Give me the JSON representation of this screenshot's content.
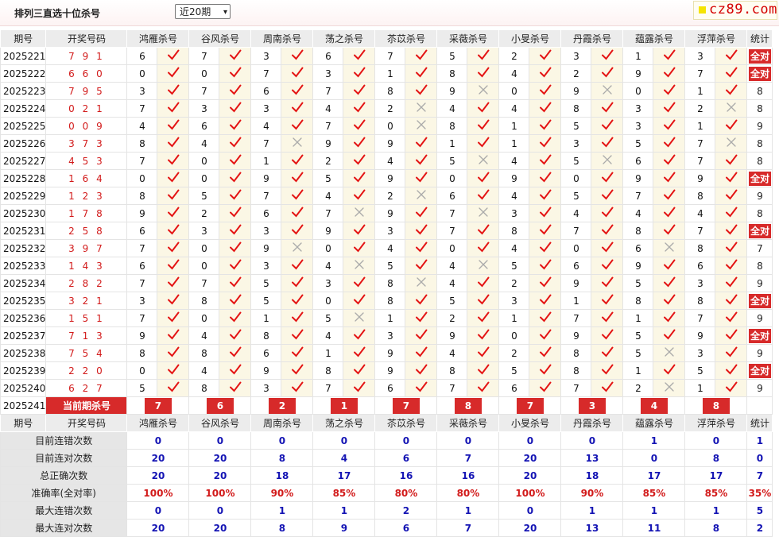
{
  "header": {
    "title": "排列三直选十位杀号",
    "period_select": "近20期",
    "logo": "cz89.com"
  },
  "columns": {
    "issue": "期号",
    "draw": "开奖号码",
    "experts": [
      "鸿雁杀号",
      "谷风杀号",
      "周南杀号",
      "荡之杀号",
      "苶苡杀号",
      "采薇杀号",
      "小旻杀号",
      "丹霞杀号",
      "蕴露杀号",
      "浮萍杀号"
    ],
    "stats": "统计"
  },
  "rows": [
    {
      "issue": "2025221",
      "draw": "7 9 1",
      "kills": [
        6,
        7,
        3,
        6,
        7,
        5,
        2,
        3,
        1,
        3
      ],
      "ok": [
        1,
        1,
        1,
        1,
        1,
        1,
        1,
        1,
        1,
        1
      ],
      "stat": "全对"
    },
    {
      "issue": "2025222",
      "draw": "6 6 0",
      "kills": [
        0,
        0,
        7,
        3,
        1,
        8,
        4,
        2,
        9,
        7
      ],
      "ok": [
        1,
        1,
        1,
        1,
        1,
        1,
        1,
        1,
        1,
        1
      ],
      "stat": "全对"
    },
    {
      "issue": "2025223",
      "draw": "7 9 5",
      "kills": [
        3,
        7,
        6,
        7,
        8,
        9,
        0,
        9,
        0,
        1
      ],
      "ok": [
        1,
        1,
        1,
        1,
        1,
        0,
        1,
        0,
        1,
        1
      ],
      "stat": "8"
    },
    {
      "issue": "2025224",
      "draw": "0 2 1",
      "kills": [
        7,
        3,
        3,
        4,
        2,
        4,
        4,
        8,
        3,
        2
      ],
      "ok": [
        1,
        1,
        1,
        1,
        0,
        1,
        1,
        1,
        1,
        0
      ],
      "stat": "8"
    },
    {
      "issue": "2025225",
      "draw": "0 0 9",
      "kills": [
        4,
        6,
        4,
        7,
        0,
        8,
        1,
        5,
        3,
        1
      ],
      "ok": [
        1,
        1,
        1,
        1,
        0,
        1,
        1,
        1,
        1,
        1
      ],
      "stat": "9"
    },
    {
      "issue": "2025226",
      "draw": "3 7 3",
      "kills": [
        8,
        4,
        7,
        9,
        9,
        1,
        1,
        3,
        5,
        7
      ],
      "ok": [
        1,
        1,
        0,
        1,
        1,
        1,
        1,
        1,
        1,
        0
      ],
      "stat": "8"
    },
    {
      "issue": "2025227",
      "draw": "4 5 3",
      "kills": [
        7,
        0,
        1,
        2,
        4,
        5,
        4,
        5,
        6,
        7
      ],
      "ok": [
        1,
        1,
        1,
        1,
        1,
        0,
        1,
        0,
        1,
        1
      ],
      "stat": "8"
    },
    {
      "issue": "2025228",
      "draw": "1 6 4",
      "kills": [
        0,
        0,
        9,
        5,
        9,
        0,
        9,
        0,
        9,
        9
      ],
      "ok": [
        1,
        1,
        1,
        1,
        1,
        1,
        1,
        1,
        1,
        1
      ],
      "stat": "全对"
    },
    {
      "issue": "2025229",
      "draw": "1 2 3",
      "kills": [
        8,
        5,
        7,
        4,
        2,
        6,
        4,
        5,
        7,
        8
      ],
      "ok": [
        1,
        1,
        1,
        1,
        0,
        1,
        1,
        1,
        1,
        1
      ],
      "stat": "9"
    },
    {
      "issue": "2025230",
      "draw": "1 7 8",
      "kills": [
        9,
        2,
        6,
        7,
        9,
        7,
        3,
        4,
        4,
        4
      ],
      "ok": [
        1,
        1,
        1,
        0,
        1,
        0,
        1,
        1,
        1,
        1
      ],
      "stat": "8"
    },
    {
      "issue": "2025231",
      "draw": "2 5 8",
      "kills": [
        6,
        3,
        3,
        9,
        3,
        7,
        8,
        7,
        8,
        7
      ],
      "ok": [
        1,
        1,
        1,
        1,
        1,
        1,
        1,
        1,
        1,
        1
      ],
      "stat": "全对"
    },
    {
      "issue": "2025232",
      "draw": "3 9 7",
      "kills": [
        7,
        0,
        9,
        0,
        4,
        0,
        4,
        0,
        6,
        8
      ],
      "ok": [
        1,
        1,
        0,
        1,
        1,
        1,
        1,
        1,
        0,
        1
      ],
      "stat": "7"
    },
    {
      "issue": "2025233",
      "draw": "1 4 3",
      "kills": [
        6,
        0,
        3,
        4,
        5,
        4,
        5,
        6,
        9,
        6
      ],
      "ok": [
        1,
        1,
        1,
        0,
        1,
        0,
        1,
        1,
        1,
        1
      ],
      "stat": "8"
    },
    {
      "issue": "2025234",
      "draw": "2 8 2",
      "kills": [
        7,
        7,
        5,
        3,
        8,
        4,
        2,
        9,
        5,
        3
      ],
      "ok": [
        1,
        1,
        1,
        1,
        0,
        1,
        1,
        1,
        1,
        1
      ],
      "stat": "9"
    },
    {
      "issue": "2025235",
      "draw": "3 2 1",
      "kills": [
        3,
        8,
        5,
        0,
        8,
        5,
        3,
        1,
        8,
        8
      ],
      "ok": [
        1,
        1,
        1,
        1,
        1,
        1,
        1,
        1,
        1,
        1
      ],
      "stat": "全对"
    },
    {
      "issue": "2025236",
      "draw": "1 5 1",
      "kills": [
        7,
        0,
        1,
        5,
        1,
        2,
        1,
        7,
        1,
        7
      ],
      "ok": [
        1,
        1,
        1,
        0,
        1,
        1,
        1,
        1,
        1,
        1
      ],
      "stat": "9"
    },
    {
      "issue": "2025237",
      "draw": "7 1 3",
      "kills": [
        9,
        4,
        8,
        4,
        3,
        9,
        0,
        9,
        5,
        9
      ],
      "ok": [
        1,
        1,
        1,
        1,
        1,
        1,
        1,
        1,
        1,
        1
      ],
      "stat": "全对"
    },
    {
      "issue": "2025238",
      "draw": "7 5 4",
      "kills": [
        8,
        8,
        6,
        1,
        9,
        4,
        2,
        8,
        5,
        3
      ],
      "ok": [
        1,
        1,
        1,
        1,
        1,
        1,
        1,
        1,
        0,
        1
      ],
      "stat": "9"
    },
    {
      "issue": "2025239",
      "draw": "2 2 0",
      "kills": [
        0,
        4,
        9,
        8,
        9,
        8,
        5,
        8,
        1,
        5
      ],
      "ok": [
        1,
        1,
        1,
        1,
        1,
        1,
        1,
        1,
        1,
        1
      ],
      "stat": "全对"
    },
    {
      "issue": "2025240",
      "draw": "6 2 7",
      "kills": [
        5,
        8,
        3,
        7,
        6,
        7,
        6,
        7,
        2,
        1
      ],
      "ok": [
        1,
        1,
        1,
        1,
        1,
        1,
        1,
        1,
        0,
        1
      ],
      "stat": "9"
    }
  ],
  "current": {
    "issue": "2025241",
    "label": "当前期杀号",
    "kills": [
      "7",
      "6",
      "2",
      "1",
      "7",
      "8",
      "7",
      "3",
      "4",
      "8"
    ]
  },
  "stats": [
    {
      "label": "目前连错次数",
      "values": [
        "0",
        "0",
        "0",
        "0",
        "0",
        "0",
        "0",
        "0",
        "1",
        "0"
      ],
      "total": "1"
    },
    {
      "label": "目前连对次数",
      "values": [
        "20",
        "20",
        "8",
        "4",
        "6",
        "7",
        "20",
        "13",
        "0",
        "8"
      ],
      "total": "0"
    },
    {
      "label": "总正确次数",
      "values": [
        "20",
        "20",
        "18",
        "17",
        "16",
        "16",
        "20",
        "18",
        "17",
        "17"
      ],
      "total": "7"
    },
    {
      "label": "准确率(全对率)",
      "values": [
        "100%",
        "100%",
        "90%",
        "85%",
        "80%",
        "80%",
        "100%",
        "90%",
        "85%",
        "85%"
      ],
      "total": "35%",
      "red": true
    },
    {
      "label": "最大连错次数",
      "values": [
        "0",
        "0",
        "1",
        "1",
        "2",
        "1",
        "0",
        "1",
        "1",
        "1"
      ],
      "total": "5"
    },
    {
      "label": "最大连对次数",
      "values": [
        "20",
        "20",
        "8",
        "9",
        "6",
        "7",
        "20",
        "13",
        "11",
        "8"
      ],
      "total": "2"
    }
  ]
}
